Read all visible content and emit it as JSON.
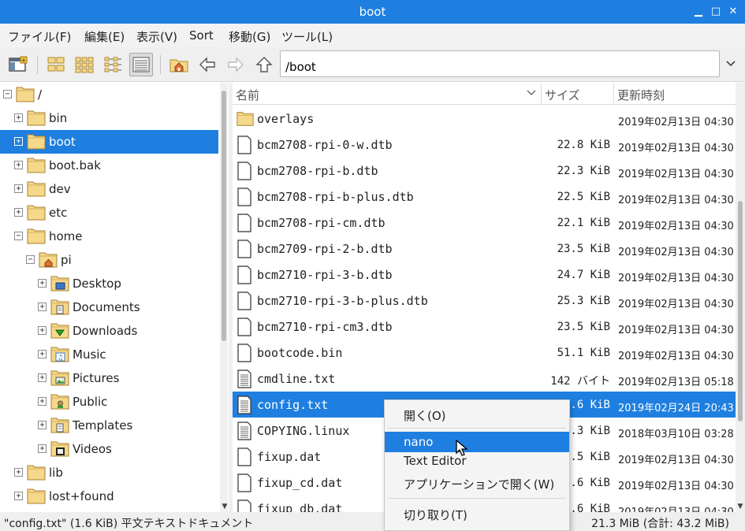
{
  "window": {
    "title": "boot"
  },
  "menu": [
    "ファイル(F)",
    "編集(E)",
    "表示(V)",
    "Sort",
    "移動(G)",
    "ツール(L)"
  ],
  "path": {
    "value": "/boot"
  },
  "tree": [
    {
      "label": "/",
      "level": 0,
      "expander": "−",
      "icon": "folder-icon"
    },
    {
      "label": "bin",
      "level": 1,
      "expander": "+",
      "icon": "folder-icon"
    },
    {
      "label": "boot",
      "level": 1,
      "expander": "+",
      "icon": "folder-icon",
      "selected": true
    },
    {
      "label": "boot.bak",
      "level": 1,
      "expander": "+",
      "icon": "folder-icon"
    },
    {
      "label": "dev",
      "level": 1,
      "expander": "+",
      "icon": "folder-icon"
    },
    {
      "label": "etc",
      "level": 1,
      "expander": "+",
      "icon": "folder-icon"
    },
    {
      "label": "home",
      "level": 1,
      "expander": "−",
      "icon": "folder-icon"
    },
    {
      "label": "pi",
      "level": 2,
      "expander": "−",
      "icon": "home-folder-icon"
    },
    {
      "label": "Desktop",
      "level": 3,
      "expander": "+",
      "icon": "desktop-folder-icon"
    },
    {
      "label": "Documents",
      "level": 3,
      "expander": "+",
      "icon": "documents-folder-icon"
    },
    {
      "label": "Downloads",
      "level": 3,
      "expander": "+",
      "icon": "downloads-folder-icon"
    },
    {
      "label": "Music",
      "level": 3,
      "expander": "+",
      "icon": "music-folder-icon"
    },
    {
      "label": "Pictures",
      "level": 3,
      "expander": "+",
      "icon": "pictures-folder-icon"
    },
    {
      "label": "Public",
      "level": 3,
      "expander": "+",
      "icon": "public-folder-icon"
    },
    {
      "label": "Templates",
      "level": 3,
      "expander": "+",
      "icon": "templates-folder-icon"
    },
    {
      "label": "Videos",
      "level": 3,
      "expander": "+",
      "icon": "videos-folder-icon"
    },
    {
      "label": "lib",
      "level": 1,
      "expander": "+",
      "icon": "folder-icon"
    },
    {
      "label": "lost+found",
      "level": 1,
      "expander": "+",
      "icon": "folder-icon"
    }
  ],
  "columns": {
    "name": "名前",
    "size": "サイズ",
    "modified": "更新時刻"
  },
  "files": [
    {
      "name": "overlays",
      "size": "",
      "modified": "2019年02月13日 04:30",
      "type": "folder"
    },
    {
      "name": "bcm2708-rpi-0-w.dtb",
      "size": "22.8 KiB",
      "modified": "2019年02月13日 04:30",
      "type": "file"
    },
    {
      "name": "bcm2708-rpi-b.dtb",
      "size": "22.3 KiB",
      "modified": "2019年02月13日 04:30",
      "type": "file"
    },
    {
      "name": "bcm2708-rpi-b-plus.dtb",
      "size": "22.5 KiB",
      "modified": "2019年02月13日 04:30",
      "type": "file"
    },
    {
      "name": "bcm2708-rpi-cm.dtb",
      "size": "22.1 KiB",
      "modified": "2019年02月13日 04:30",
      "type": "file"
    },
    {
      "name": "bcm2709-rpi-2-b.dtb",
      "size": "23.5 KiB",
      "modified": "2019年02月13日 04:30",
      "type": "file"
    },
    {
      "name": "bcm2710-rpi-3-b.dtb",
      "size": "24.7 KiB",
      "modified": "2019年02月13日 04:30",
      "type": "file"
    },
    {
      "name": "bcm2710-rpi-3-b-plus.dtb",
      "size": "25.3 KiB",
      "modified": "2019年02月13日 04:30",
      "type": "file"
    },
    {
      "name": "bcm2710-rpi-cm3.dtb",
      "size": "23.5 KiB",
      "modified": "2019年02月13日 04:30",
      "type": "file"
    },
    {
      "name": "bootcode.bin",
      "size": "51.1 KiB",
      "modified": "2019年02月13日 04:30",
      "type": "file"
    },
    {
      "name": "cmdline.txt",
      "size": "142 バイト",
      "modified": "2019年02月13日 05:18",
      "type": "text"
    },
    {
      "name": "config.txt",
      "size": "1.6 KiB",
      "modified": "2019年02月24日 20:43",
      "type": "text",
      "selected": true
    },
    {
      "name": "COPYING.linux",
      "size": "18.3 KiB",
      "modified": "2018年03月10日 03:28",
      "type": "text"
    },
    {
      "name": "fixup.dat",
      "size": "6.5 KiB",
      "modified": "2019年02月13日 04:30",
      "type": "file"
    },
    {
      "name": "fixup_cd.dat",
      "size": "2.6 KiB",
      "modified": "2019年02月13日 04:30",
      "type": "file"
    },
    {
      "name": "fixup_db.dat",
      "size": "9.6 KiB",
      "modified": "2019年02月13日 04:30",
      "type": "file"
    }
  ],
  "context_menu": {
    "open": "開く(O)",
    "nano": "nano",
    "text_editor": "Text Editor",
    "open_with": "アプリケーションで開く(W)",
    "cut": "切り取り(T)"
  },
  "status": {
    "left": "\"config.txt\" (1.6 KiB) 平文テキストドキュメント",
    "right": "21.3 MiB (合計: 43.2 MiB)"
  },
  "colors": {
    "accent": "#1e7fe0",
    "folder": "#f5d88a"
  }
}
